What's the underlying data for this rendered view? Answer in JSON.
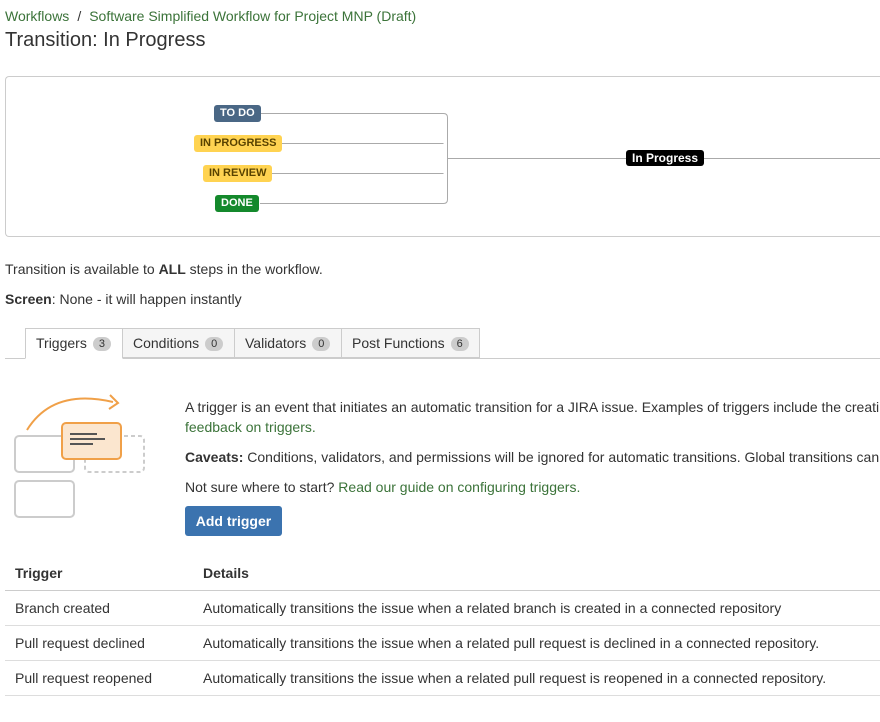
{
  "breadcrumb": {
    "root": "Workflows",
    "separator": "/",
    "current": "Software Simplified Workflow for Project MNP (Draft)"
  },
  "page_title": "Transition: In Progress",
  "diagram": {
    "source_statuses": [
      {
        "label": "TO DO",
        "color": "#4a6785"
      },
      {
        "label": "IN PROGRESS",
        "color": "#ffd351"
      },
      {
        "label": "IN REVIEW",
        "color": "#ffd351"
      },
      {
        "label": "DONE",
        "color": "#14892c"
      }
    ],
    "target_status": "In Progress"
  },
  "availability": {
    "prefix": "Transition is available to ",
    "emphasis": "ALL",
    "suffix": " steps in the workflow."
  },
  "screen": {
    "label": "Screen",
    "value": ": None - it will happen instantly"
  },
  "tabs": [
    {
      "label": "Triggers",
      "count": "3",
      "active": true
    },
    {
      "label": "Conditions",
      "count": "0",
      "active": false
    },
    {
      "label": "Validators",
      "count": "0",
      "active": false
    },
    {
      "label": "Post Functions",
      "count": "6",
      "active": false
    }
  ],
  "triggers_panel": {
    "intro": "A trigger is an event that initiates an automatic transition for a JIRA issue. Examples of triggers include the creati",
    "feedback_link": "feedback on triggers.",
    "caveats_label": "Caveats:",
    "caveats_text": " Conditions, validators, and permissions will be ignored for automatic transitions. Global transitions can",
    "guide_prefix": "Not sure where to start? ",
    "guide_link": "Read our guide on configuring triggers.",
    "add_button": "Add trigger"
  },
  "trigger_table": {
    "headers": [
      "Trigger",
      "Details"
    ],
    "rows": [
      {
        "trigger": "Branch created",
        "details": "Automatically transitions the issue when a related branch is created in a connected repository"
      },
      {
        "trigger": "Pull request declined",
        "details": "Automatically transitions the issue when a related pull request is declined in a connected repository."
      },
      {
        "trigger": "Pull request reopened",
        "details": "Automatically transitions the issue when a related pull request is reopened in a connected repository."
      }
    ]
  },
  "colors": {
    "link": "#3b7339",
    "primary_button": "#3b73af",
    "illustration_accent": "#f0a048"
  }
}
